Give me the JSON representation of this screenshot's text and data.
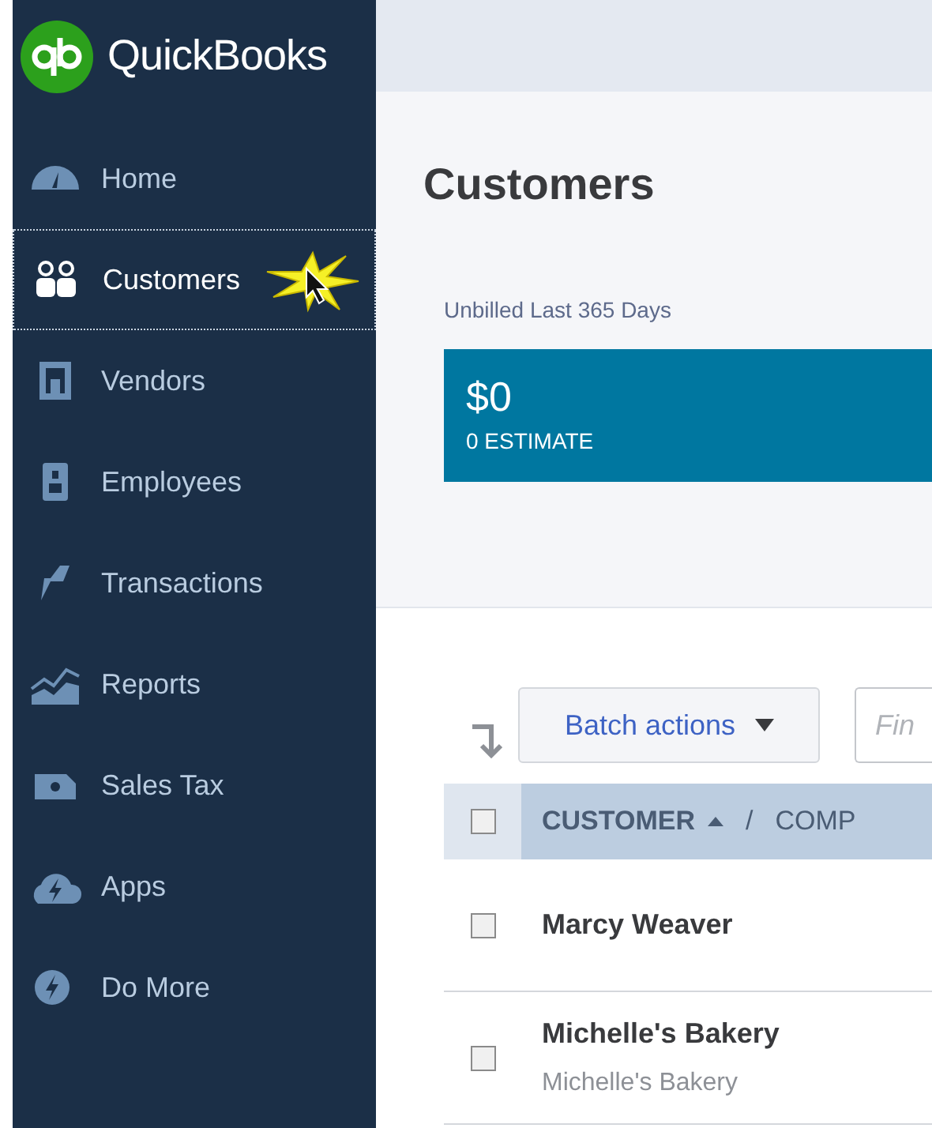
{
  "brand": "QuickBooks",
  "sidebar": {
    "items": [
      {
        "label": "Home",
        "selected": false
      },
      {
        "label": "Customers",
        "selected": true
      },
      {
        "label": "Vendors",
        "selected": false
      },
      {
        "label": "Employees",
        "selected": false
      },
      {
        "label": "Transactions",
        "selected": false
      },
      {
        "label": "Reports",
        "selected": false
      },
      {
        "label": "Sales Tax",
        "selected": false
      },
      {
        "label": "Apps",
        "selected": false
      },
      {
        "label": "Do More",
        "selected": false
      }
    ]
  },
  "page": {
    "title": "Customers",
    "unbilled_label": "Unbilled Last 365 Days",
    "unbilled_amount": "$0",
    "unbilled_count": "0 ESTIMATE"
  },
  "toolbar": {
    "batch_actions": "Batch actions",
    "search": {
      "placeholder": "Fin"
    }
  },
  "table": {
    "select_all_checked": false,
    "columns": [
      {
        "label": "CUSTOMER",
        "sorted": true
      },
      {
        "label": "/",
        "sorted": false
      },
      {
        "label": "COMP",
        "sorted": false
      }
    ],
    "rows": [
      {
        "name": "Marcy Weaver",
        "checked": false
      },
      {
        "name": "Michelle's Bakery",
        "company": "Michelle's Bakery",
        "checked": false
      }
    ]
  }
}
